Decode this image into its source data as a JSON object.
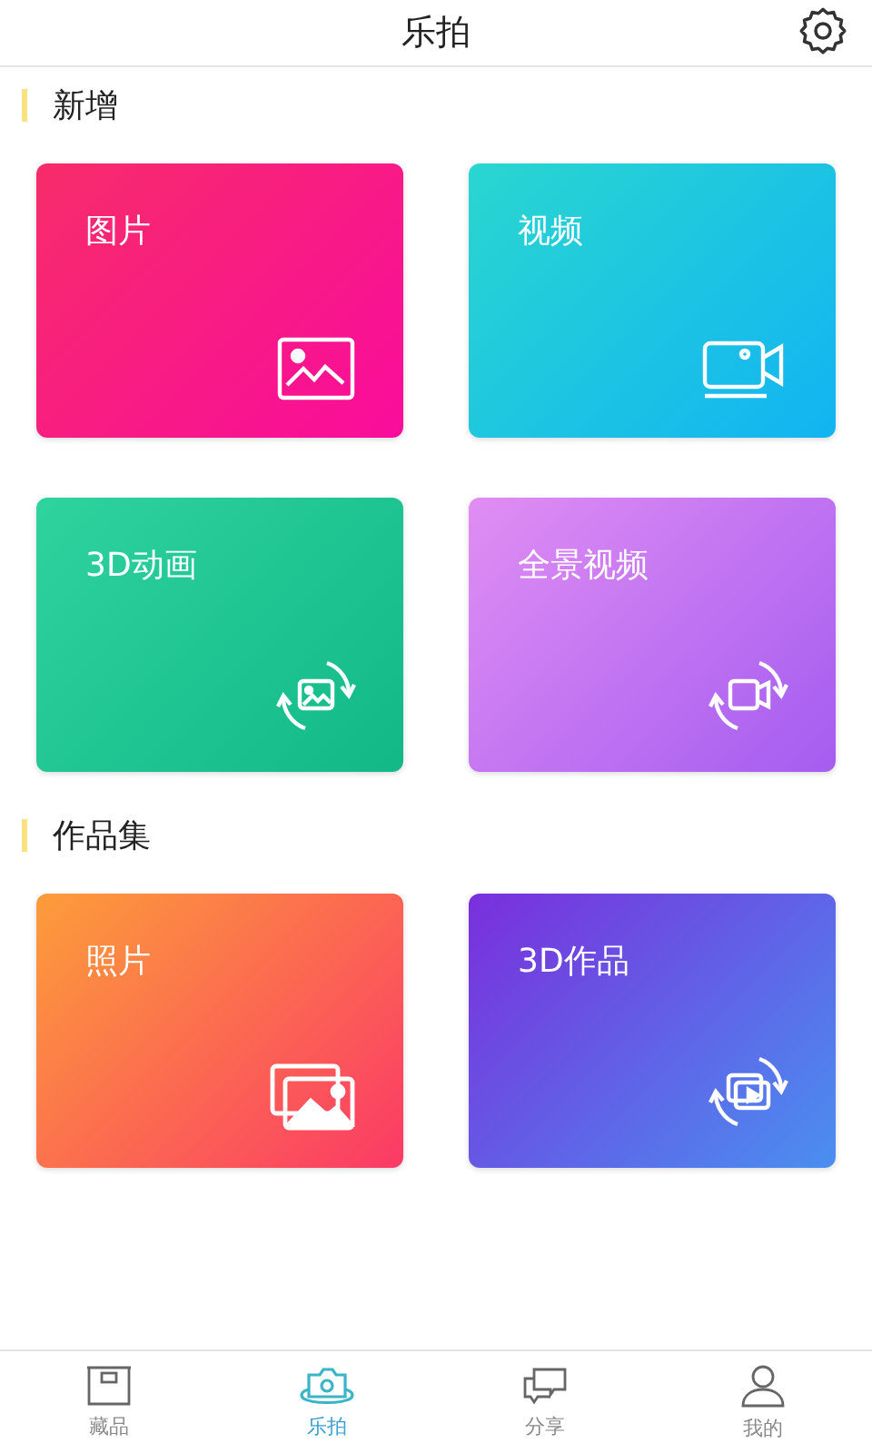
{
  "header": {
    "title": "乐拍"
  },
  "sections": [
    {
      "title": "新增",
      "cards": [
        {
          "label": "图片",
          "kind": "image",
          "color": "#f72c6a"
        },
        {
          "label": "视频",
          "kind": "video",
          "color": "#2ad6d0"
        },
        {
          "label": "3D动画",
          "kind": "rotate-image",
          "color": "#2ed39e"
        },
        {
          "label": "全景视频",
          "kind": "rotate-video",
          "color": "#e08ef3"
        }
      ]
    },
    {
      "title": "作品集",
      "cards": [
        {
          "label": "照片",
          "kind": "photos",
          "color": "#fc9d3a"
        },
        {
          "label": "3D作品",
          "kind": "rotate-play",
          "color": "#7a2fdc"
        }
      ]
    }
  ],
  "tabs": [
    {
      "label": "藏品",
      "kind": "box",
      "selected": false
    },
    {
      "label": "乐拍",
      "kind": "camera",
      "selected": true
    },
    {
      "label": "分享",
      "kind": "chat",
      "selected": false
    },
    {
      "label": "我的",
      "kind": "person",
      "selected": false
    }
  ]
}
